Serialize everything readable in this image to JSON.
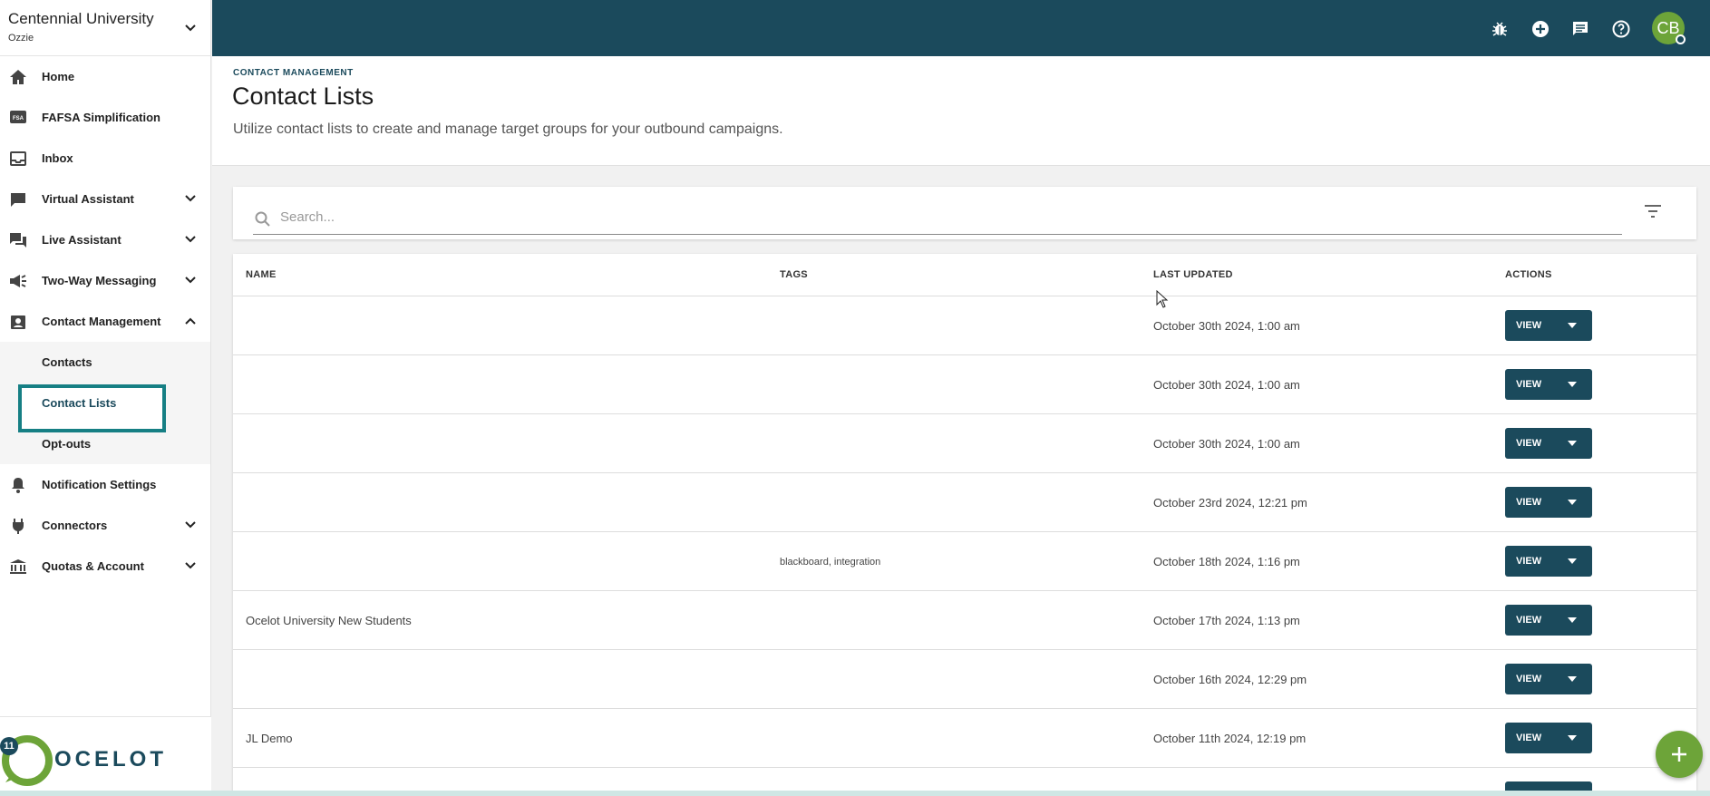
{
  "org": {
    "name": "Centennial University",
    "user": "Ozzie"
  },
  "sidebar": {
    "items": [
      {
        "label": "Home"
      },
      {
        "label": "FAFSA Simplification",
        "icon_text": "FSA"
      },
      {
        "label": "Inbox"
      },
      {
        "label": "Virtual Assistant"
      },
      {
        "label": "Live Assistant"
      },
      {
        "label": "Two-Way Messaging"
      },
      {
        "label": "Contact Management"
      },
      {
        "label": "Notification Settings"
      },
      {
        "label": "Connectors"
      },
      {
        "label": "Quotas & Account"
      }
    ],
    "sub_items": [
      {
        "label": "Contacts"
      },
      {
        "label": "Contact Lists"
      },
      {
        "label": "Opt-outs"
      }
    ],
    "logo_text": "OCELOT",
    "badge_count": "11"
  },
  "topbar": {
    "avatar_initials": "CB"
  },
  "header": {
    "breadcrumb": "CONTACT MANAGEMENT",
    "title": "Contact Lists",
    "subtitle": "Utilize contact lists to create and manage target groups for your outbound campaigns."
  },
  "search": {
    "placeholder": "Search..."
  },
  "table": {
    "columns": [
      "NAME",
      "TAGS",
      "LAST UPDATED",
      "ACTIONS"
    ],
    "action_label": "VIEW",
    "rows": [
      {
        "name": "",
        "tags": "",
        "updated": "October 30th 2024, 1:00 am"
      },
      {
        "name": "",
        "tags": "",
        "updated": "October 30th 2024, 1:00 am"
      },
      {
        "name": "",
        "tags": "",
        "updated": "October 30th 2024, 1:00 am"
      },
      {
        "name": "",
        "tags": "",
        "updated": "October 23rd 2024, 12:21 pm"
      },
      {
        "name": "",
        "tags": "blackboard, integration",
        "updated": "October 18th 2024, 1:16 pm"
      },
      {
        "name": "Ocelot University New Students",
        "tags": "",
        "updated": "October 17th 2024, 1:13 pm"
      },
      {
        "name": "",
        "tags": "",
        "updated": "October 16th 2024, 12:29 pm"
      },
      {
        "name": "JL Demo",
        "tags": "",
        "updated": "October 11th 2024, 12:19 pm"
      }
    ]
  },
  "colors": {
    "primary": "#1b4a5c",
    "accent": "#6da439",
    "highlight": "#167f84"
  }
}
